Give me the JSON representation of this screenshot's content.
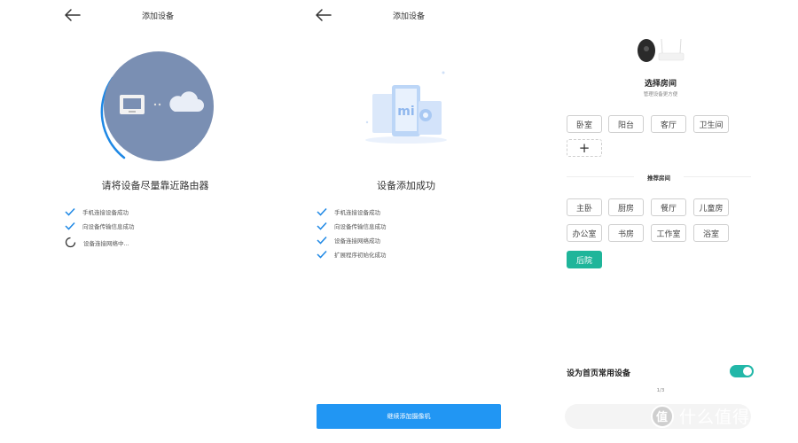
{
  "screen1": {
    "title": "添加设备",
    "heading": "请将设备尽量靠近路由器",
    "steps": [
      {
        "label": "手机连接设备成功",
        "status": "done"
      },
      {
        "label": "向设备传输信息成功",
        "status": "done"
      },
      {
        "label": "设备连接网络中...",
        "status": "loading"
      }
    ]
  },
  "screen2": {
    "title": "添加设备",
    "heading": "设备添加成功",
    "steps": [
      {
        "label": "手机连接设备成功",
        "status": "done"
      },
      {
        "label": "向设备传输信息成功",
        "status": "done"
      },
      {
        "label": "设备连接网络成功",
        "status": "done"
      },
      {
        "label": "扩展程序初始化成功",
        "status": "done"
      }
    ],
    "button_label": "继续添加摄像机"
  },
  "screen3": {
    "heading": "选择房间",
    "subheading": "管理设备更方便",
    "rooms": [
      "卧室",
      "阳台",
      "客厅",
      "卫生间"
    ],
    "add_room_symbol": "+",
    "recommended_heading": "推荐房间",
    "recommended_rooms": [
      "主卧",
      "厨房",
      "餐厅",
      "儿童房",
      "办公室",
      "书房",
      "工作室",
      "浴室",
      "后院"
    ],
    "selected_room": "后院",
    "toggle_label": "设为首页常用设备",
    "toggle_on": true,
    "pager": "1/3"
  },
  "watermark": {
    "logo_text": "值",
    "text": "什么值得买"
  },
  "colors": {
    "accent_blue": "#2196f3",
    "accent_teal": "#1fb59a",
    "circle_fill": "#7a8fb3",
    "check_blue": "#1e88e5"
  }
}
